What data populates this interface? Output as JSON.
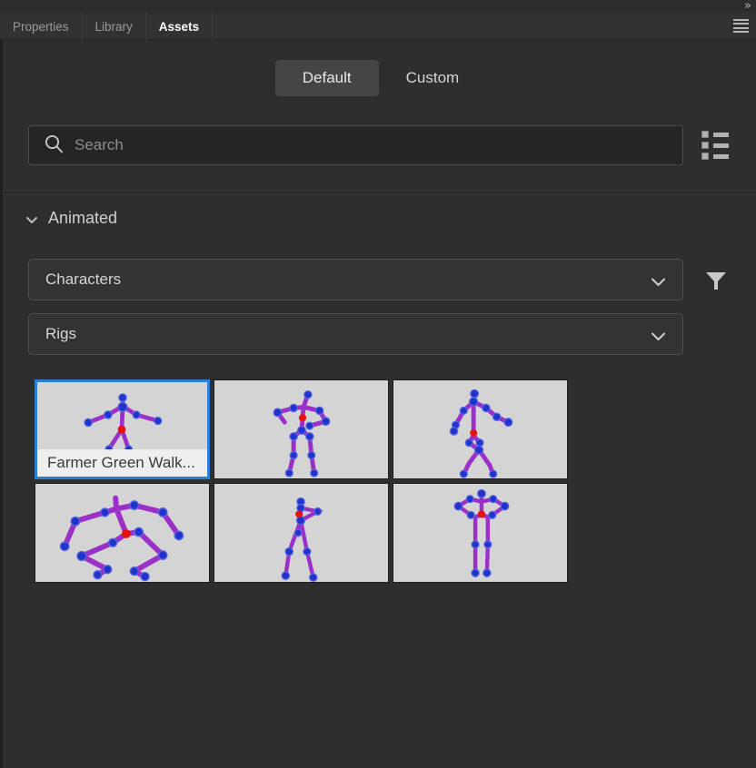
{
  "window": {
    "more_chevron": "»",
    "panel_menu_icon": "hamburger-icon"
  },
  "tabs": [
    {
      "label": "Properties",
      "active": false
    },
    {
      "label": "Library",
      "active": false
    },
    {
      "label": "Assets",
      "active": true
    }
  ],
  "segmented": {
    "options": [
      {
        "label": "Default",
        "active": true
      },
      {
        "label": "Custom",
        "active": false
      }
    ]
  },
  "search": {
    "value": "",
    "placeholder": "Search",
    "icon": "search-icon",
    "view_toggle_icon": "list-view-icon"
  },
  "section": {
    "title": "Animated",
    "expanded": true,
    "chevron_icon": "chevron-down-icon"
  },
  "filters": {
    "category": {
      "label": "Characters",
      "chevron_icon": "chevron-down-icon"
    },
    "type": {
      "label": "Rigs",
      "chevron_icon": "chevron-down-icon"
    },
    "filter_icon": "filter-funnel-icon"
  },
  "assets": [
    {
      "name": "Farmer Green Walk...",
      "selected": true,
      "pose": "walk-arms-out",
      "show_label": true
    },
    {
      "name": "",
      "selected": false,
      "pose": "hands-on-hips",
      "show_label": false
    },
    {
      "name": "",
      "selected": false,
      "pose": "side-walk",
      "show_label": false
    },
    {
      "name": "",
      "selected": false,
      "pose": "quadruped-crawl",
      "show_label": false
    },
    {
      "name": "",
      "selected": false,
      "pose": "side-stand",
      "show_label": false
    },
    {
      "name": "",
      "selected": false,
      "pose": "front-stand-tpose",
      "show_label": false
    }
  ],
  "colors": {
    "panel_bg": "#2e2e2e",
    "tabbar_bg": "#323232",
    "accent_selection": "#2a7fd4",
    "thumb_bg": "#d4d4d4",
    "rig_bone": "#9b30c8",
    "rig_joint": "#2233cc",
    "rig_root": "#e81010",
    "text_primary": "#d6d6d6",
    "text_muted": "#9a9a9a"
  }
}
